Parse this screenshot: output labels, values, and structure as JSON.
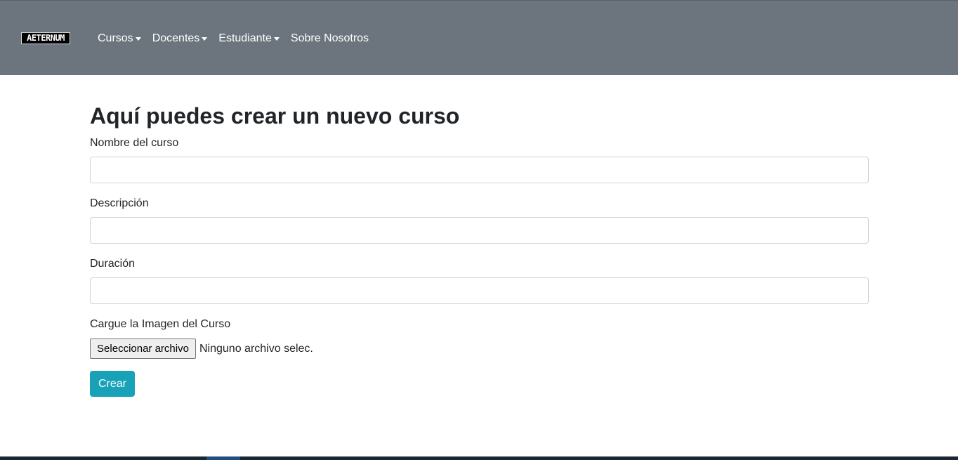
{
  "navbar": {
    "brand": "AETERNUM",
    "items": [
      {
        "label": "Cursos",
        "dropdown": true
      },
      {
        "label": "Docentes",
        "dropdown": true
      },
      {
        "label": "Estudiante",
        "dropdown": true
      },
      {
        "label": "Sobre Nosotros",
        "dropdown": false
      }
    ],
    "background": "#6c757d"
  },
  "form": {
    "title": "Aquí puedes crear un nuevo curso",
    "fields": [
      {
        "label": "Nombre del curso",
        "value": ""
      },
      {
        "label": "Descripción",
        "value": ""
      },
      {
        "label": "Duración",
        "value": ""
      }
    ],
    "file": {
      "label": "Cargue la Imagen del Curso",
      "button_label": "Seleccionar archivo",
      "status": "Ninguno archivo selec."
    },
    "submit_label": "Crear",
    "submit_color": "#17a2b8"
  }
}
